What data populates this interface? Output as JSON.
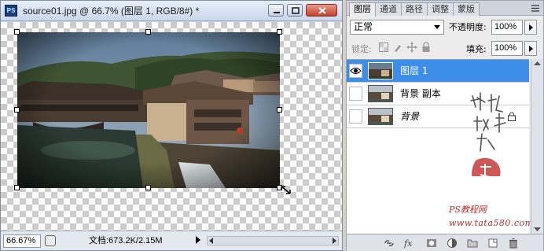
{
  "document_window": {
    "title": "source01.jpg @ 66.7% (图层 1, RGB/8#) *",
    "app_icon": "PS",
    "status": {
      "zoom": "66.67%",
      "doc_info": "文档:673.2K/2.15M"
    }
  },
  "layers_panel": {
    "tabs": [
      {
        "label": "图层",
        "active": true
      },
      {
        "label": "通道",
        "active": false
      },
      {
        "label": "路径",
        "active": false
      },
      {
        "label": "调整",
        "active": false
      },
      {
        "label": "蒙版",
        "active": false
      }
    ],
    "blend_mode": "正常",
    "opacity_label": "不透明度:",
    "opacity_value": "100%",
    "lock_label": "锁定:",
    "fill_label": "填充:",
    "fill_value": "100%",
    "layers": [
      {
        "name": "图层 1",
        "selected": true,
        "visible": true
      },
      {
        "name": "背景 副本",
        "selected": false,
        "visible": false
      },
      {
        "name": "背景",
        "selected": false,
        "visible": false,
        "locked": true
      }
    ],
    "watermark": {
      "text_a": "PS教程网",
      "text_b": "www.tata580.com"
    }
  },
  "colors": {
    "selected_layer": "#3d8ee8",
    "title_bar": "#cbd8ea",
    "watermark": "#b72c2c"
  }
}
